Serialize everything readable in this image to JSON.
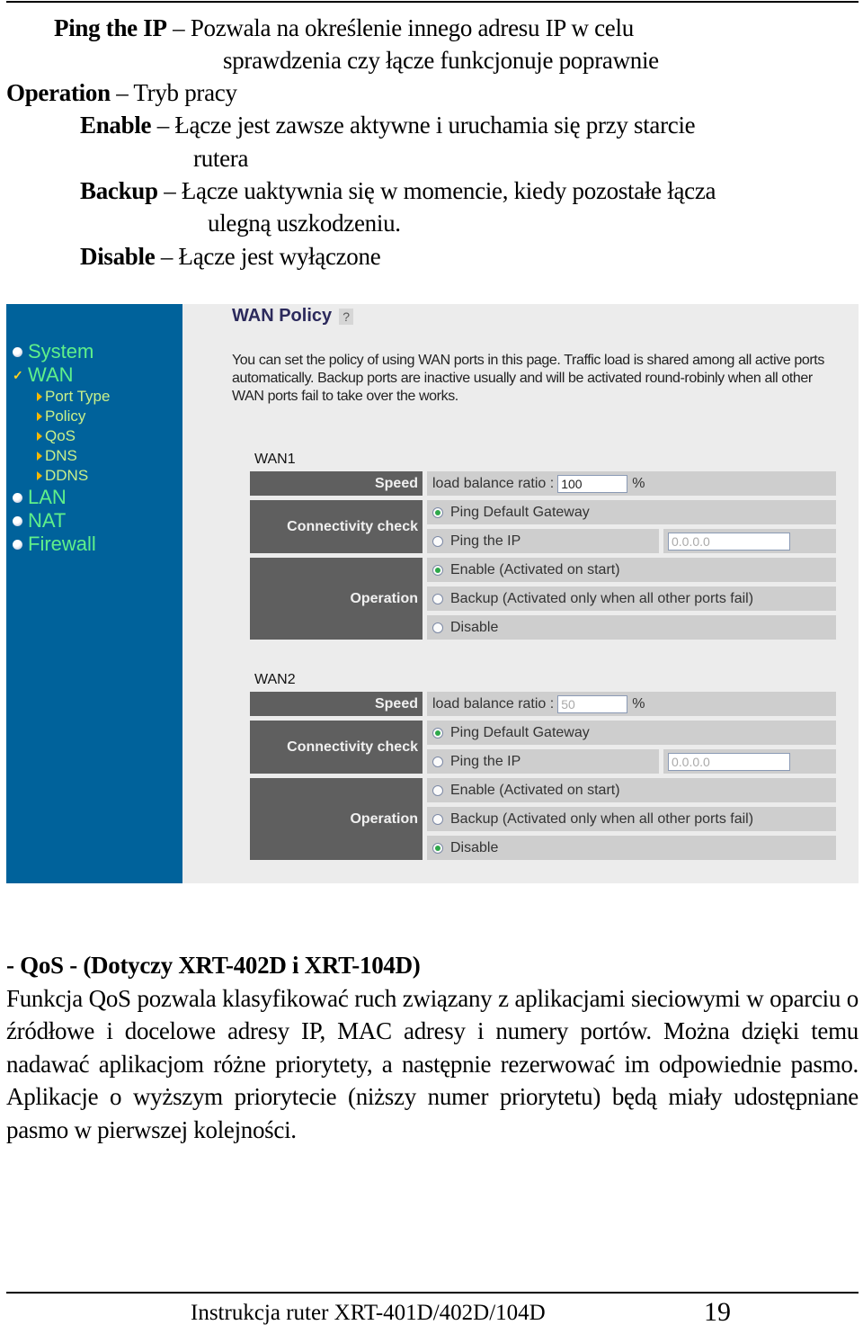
{
  "intro": {
    "ping_ip_term": "Ping the IP",
    "ping_ip_desc_1": "Pozwala na określenie innego adresu IP w celu",
    "ping_ip_desc_2": "sprawdzenia czy łącze funkcjonuje poprawnie",
    "operation_term": "Operation",
    "operation_desc": "Tryb pracy",
    "enable_term": "Enable",
    "enable_desc_1": "Łącze jest zawsze aktywne i uruchamia się przy starcie",
    "enable_desc_2": "rutera",
    "backup_term": "Backup",
    "backup_desc_1": "Łącze uaktywnia się w momencie, kiedy pozostałe łącza",
    "backup_desc_2": "ulegną uszkodzeniu.",
    "disable_term": "Disable",
    "disable_desc": "Łącze jest wyłączone",
    "dash": "–"
  },
  "router_ui": {
    "sidebar": {
      "items": [
        {
          "label": "System",
          "icon": "bullet-icon"
        },
        {
          "label": "WAN",
          "icon": "check-icon"
        },
        {
          "label": "LAN",
          "icon": "bullet-icon"
        },
        {
          "label": "NAT",
          "icon": "bullet-icon"
        },
        {
          "label": "Firewall",
          "icon": "bullet-icon"
        }
      ],
      "wan_subitems": [
        "Port Type",
        "Policy",
        "QoS",
        "DNS",
        "DDNS"
      ]
    },
    "title": "WAN Policy",
    "help_icon": "?",
    "description": "You can set the policy of using WAN ports in this page. Traffic load is shared among all active ports automatically. Backup ports are inactive usually and will be activated round-robinly when all other WAN ports fail to take over the works.",
    "labels": {
      "speed": "Speed",
      "connectivity": "Connectivity check",
      "operation": "Operation",
      "load_balance": "load balance ratio :",
      "percent": "%",
      "ping_gateway": "Ping Default Gateway",
      "ping_ip": "Ping the IP",
      "enable": "Enable (Activated on start)",
      "backup": "Backup (Activated only when all other ports fail)",
      "disable": "Disable"
    },
    "wans": [
      {
        "name": "WAN1",
        "ratio": "100",
        "ip": "0.0.0.0",
        "connectivity": "ping_gateway",
        "operation": "enable"
      },
      {
        "name": "WAN2",
        "ratio": "50",
        "ip": "0.0.0.0",
        "connectivity": "ping_gateway",
        "operation": "disable"
      }
    ]
  },
  "qos": {
    "heading": "- QoS -  (Dotyczy XRT-402D i XRT-104D)",
    "body": "Funkcja QoS pozwala klasyfikować ruch związany z aplikacjami sieciowymi w oparciu o źródłowe i docelowe adresy IP, MAC adresy i numery portów. Można dzięki temu nadawać aplikacjom różne priorytety, a następnie rezerwować im odpowiednie pasmo. Aplikacje o wyższym priorytecie (niższy numer priorytetu) będą miały udostępniane pasmo w pierwszej kolejności."
  },
  "footer": {
    "text": "Instrukcja ruter XRT-401D/402D/104D",
    "page": "19"
  },
  "colors": {
    "sidebar_bg": "#00629b",
    "nav_green": "#5ff08a",
    "header_cell": "#5f5f5f",
    "value_cell": "#cecece",
    "panel_bg": "#ececec"
  }
}
